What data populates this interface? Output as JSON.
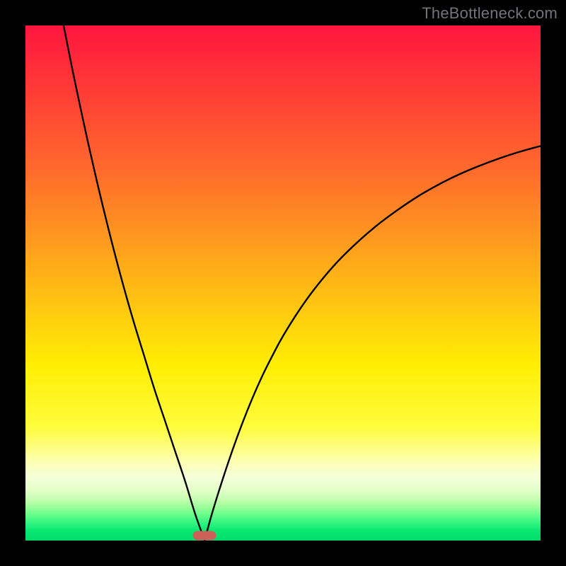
{
  "watermark": "TheBottleneck.com",
  "marker": {
    "x_pct": 34.8,
    "y_pct": 99.1,
    "color": "#cb6159"
  },
  "chart_data": {
    "type": "line",
    "title": "",
    "xlabel": "",
    "ylabel": "",
    "xlim": [
      0,
      100
    ],
    "ylim": [
      0,
      100
    ],
    "series": [
      {
        "name": "left-branch",
        "x": [
          7.4,
          9,
          11,
          13,
          15,
          17,
          19,
          21,
          23,
          25,
          27,
          29,
          31,
          33,
          34.8
        ],
        "y": [
          100,
          92,
          82.5,
          73.5,
          65,
          57,
          49.5,
          42.5,
          36,
          29.5,
          23.5,
          17.5,
          11.5,
          5,
          0
        ]
      },
      {
        "name": "right-branch",
        "x": [
          34.8,
          36,
          38,
          40,
          42,
          44,
          46,
          48,
          50,
          53,
          56,
          60,
          64,
          68,
          72,
          76,
          80,
          84,
          88,
          92,
          96,
          100
        ],
        "y": [
          0,
          4.5,
          11,
          17,
          22.5,
          27.5,
          32,
          36,
          39.7,
          44.5,
          48.7,
          53.5,
          57.5,
          61,
          64,
          66.7,
          69,
          71,
          72.7,
          74.2,
          75.5,
          76.6
        ]
      }
    ],
    "gradient_stops": [
      {
        "pct": 0,
        "color": "#ff153e"
      },
      {
        "pct": 28,
        "color": "#ff6a2c"
      },
      {
        "pct": 50,
        "color": "#ffb716"
      },
      {
        "pct": 66,
        "color": "#ffee04"
      },
      {
        "pct": 78,
        "color": "#fffc3c"
      },
      {
        "pct": 84.5,
        "color": "#fdffb0"
      },
      {
        "pct": 87.5,
        "color": "#f6ffd8"
      },
      {
        "pct": 90,
        "color": "#e5ffcb"
      },
      {
        "pct": 92,
        "color": "#c6ffb1"
      },
      {
        "pct": 93.5,
        "color": "#9bff99"
      },
      {
        "pct": 95,
        "color": "#68fd8a"
      },
      {
        "pct": 96.5,
        "color": "#33f57f"
      },
      {
        "pct": 98,
        "color": "#0ae873"
      },
      {
        "pct": 100,
        "color": "#00dd6a"
      }
    ]
  }
}
